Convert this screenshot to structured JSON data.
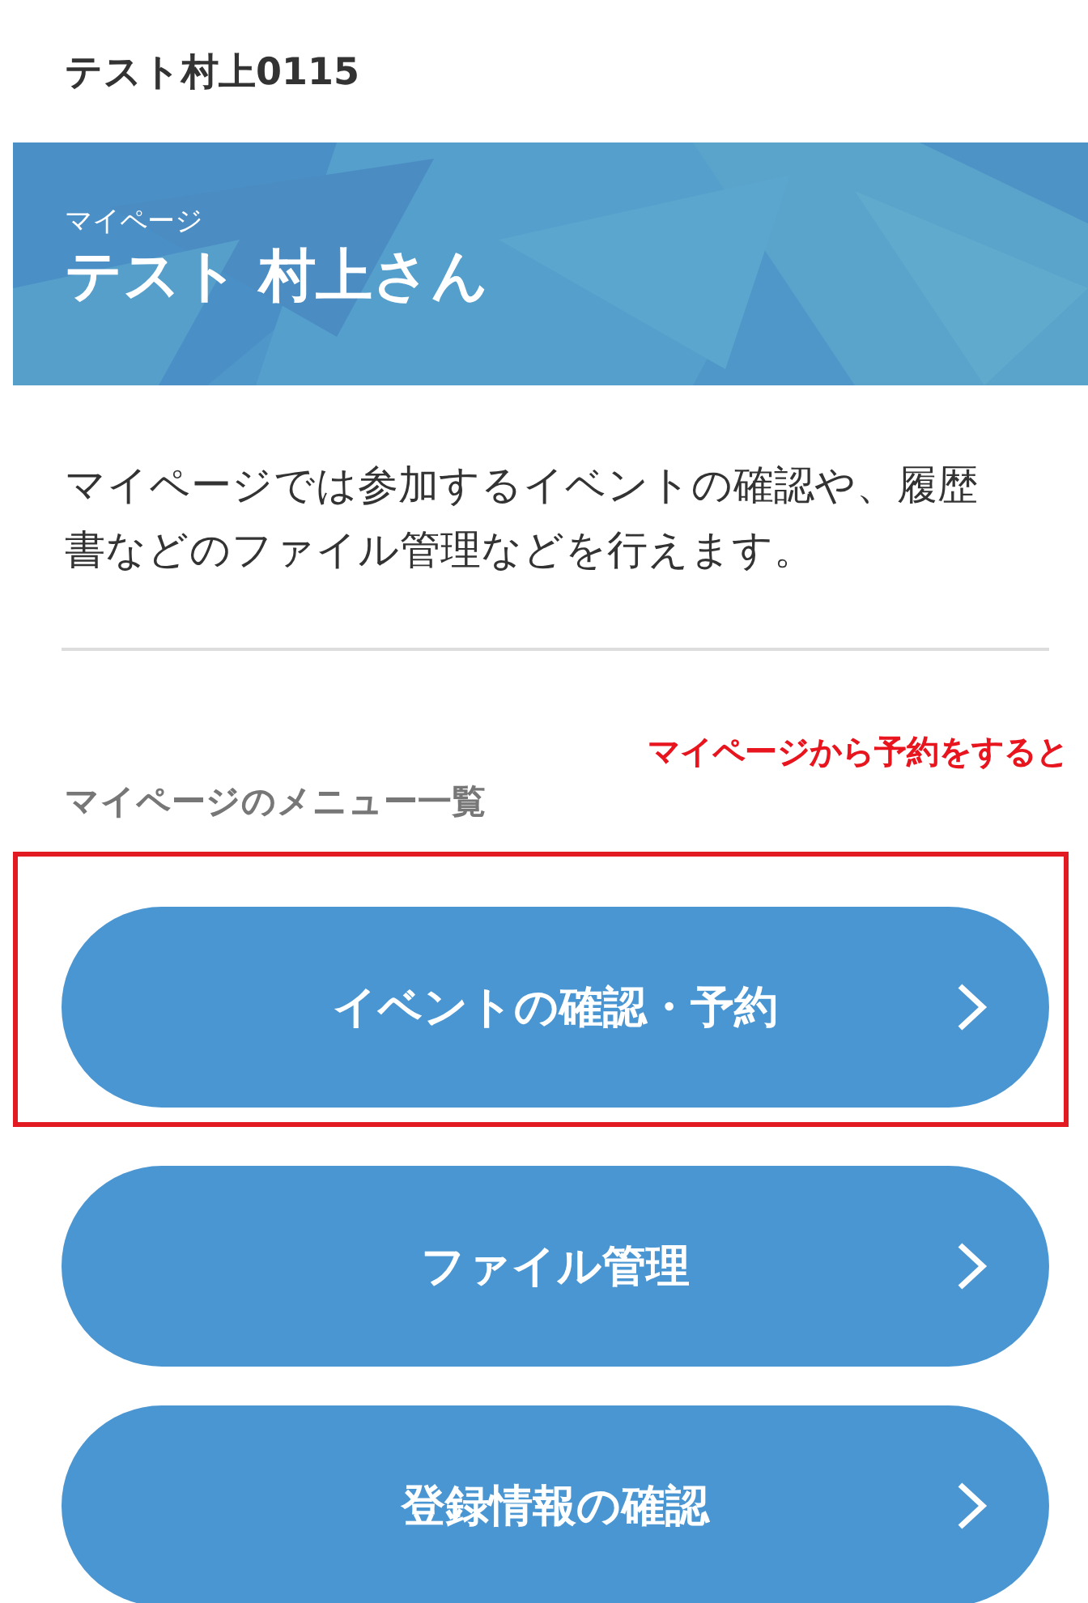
{
  "header": {
    "title": "テスト村上0115"
  },
  "banner": {
    "kind": "picture",
    "subtitle": "マイページ",
    "name": "テスト 村上さん"
  },
  "description": "マイページでは参加するイベントの確認や、履歴書などのファイル管理などを行えます。",
  "annotation": {
    "text": "マイページから予約をすると"
  },
  "menu": {
    "heading": "マイページのメニュー一覧",
    "items": [
      {
        "label": "イベントの確認・予約",
        "highlighted": true
      },
      {
        "label": "ファイル管理",
        "highlighted": false
      },
      {
        "label": "登録情報の確認",
        "highlighted": false
      }
    ]
  }
}
